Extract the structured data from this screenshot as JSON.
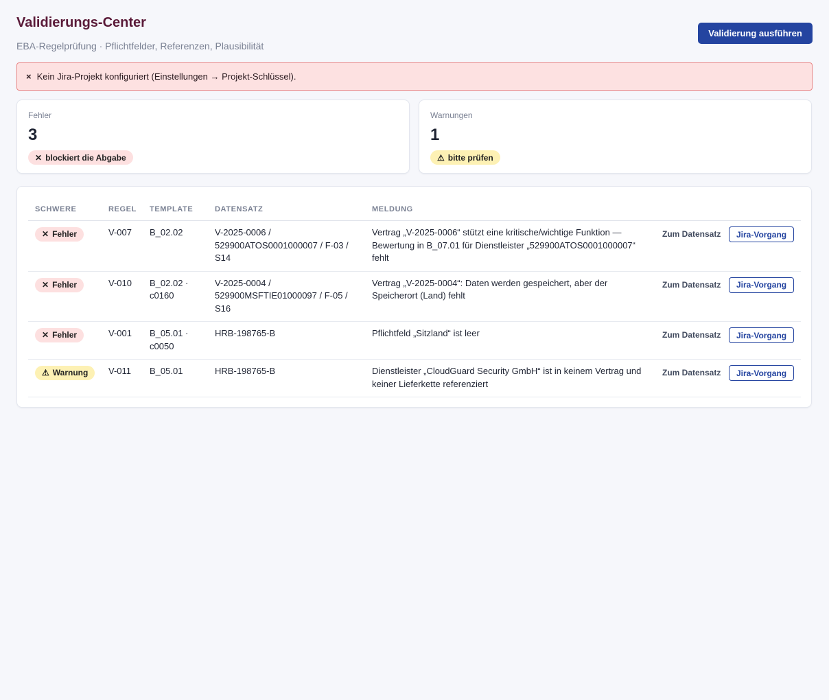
{
  "header": {
    "title": "Validierungs-Center",
    "subtitle": "EBA-Regelprüfung · Pflichtfelder, Referenzen, Plausibilität",
    "run_button": "Validierung ausführen"
  },
  "alert": {
    "icon": "×",
    "text": "Kein Jira-Projekt konfiguriert (Einstellungen → Projekt-Schlüssel)."
  },
  "summary": {
    "errors": {
      "label": "Fehler",
      "value": "3",
      "badge_icon": "✕",
      "badge_text": "blockiert die Abgabe"
    },
    "warnings": {
      "label": "Warnungen",
      "value": "1",
      "badge_icon": "⚠",
      "badge_text": "bitte prüfen"
    }
  },
  "table": {
    "columns": [
      "SCHWERE",
      "REGEL",
      "TEMPLATE",
      "DATENSATZ",
      "MELDUNG"
    ],
    "action_record": "Zum Datensatz",
    "action_jira": "Jira-Vorgang",
    "rows": [
      {
        "severity": "error",
        "severity_icon": "✕",
        "severity_label": "Fehler",
        "rule": "V-007",
        "template": "B_02.02",
        "record": "V-2025-0006 / 529900ATOS0001000007 / F-03 / S14",
        "message": "Vertrag „V-2025-0006“ stützt eine kritische/wichtige Funktion — Bewertung in B_07.01 für Dienstleister „529900ATOS0001000007“ fehlt"
      },
      {
        "severity": "error",
        "severity_icon": "✕",
        "severity_label": "Fehler",
        "rule": "V-010",
        "template": "B_02.02 · c0160",
        "record": "V-2025-0004 / 529900MSFTIE01000097 / F-05 / S16",
        "message": "Vertrag „V-2025-0004“: Daten werden gespeichert, aber der Speicherort (Land) fehlt"
      },
      {
        "severity": "error",
        "severity_icon": "✕",
        "severity_label": "Fehler",
        "rule": "V-001",
        "template": "B_05.01 · c0050",
        "record": "HRB-198765-B",
        "message": "Pflichtfeld „Sitzland“ ist leer"
      },
      {
        "severity": "warning",
        "severity_icon": "⚠",
        "severity_label": "Warnung",
        "rule": "V-011",
        "template": "B_05.01",
        "record": "HRB-198765-B",
        "message": "Dienstleister „CloudGuard Security GmbH“ ist in keinem Vertrag und keiner Lieferkette referenziert"
      }
    ]
  },
  "colors": {
    "accent": "#2444a0",
    "title": "#5a1a38",
    "error_bg": "#fde0e0",
    "warning_bg": "#fdf1b4",
    "alert_bg": "#fde1e1",
    "alert_border": "#e98585"
  }
}
